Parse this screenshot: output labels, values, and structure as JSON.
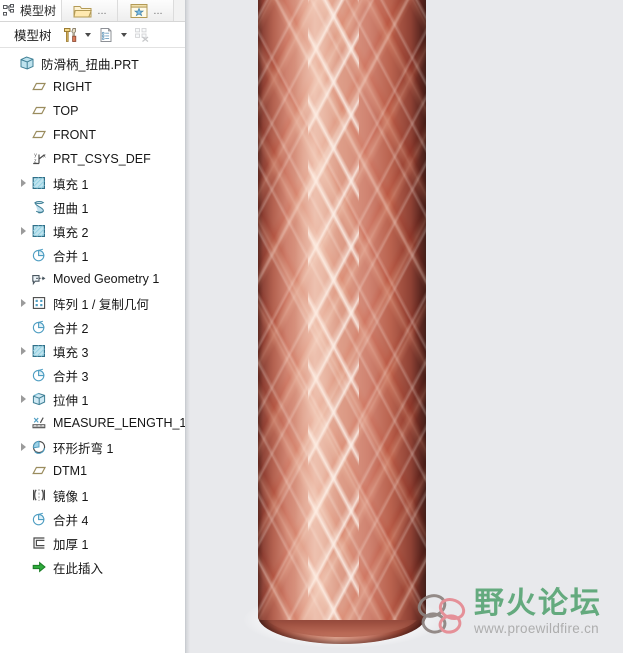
{
  "window": {
    "tabs": [
      {
        "label": "模型树",
        "icon": "tree-hierarchy-icon",
        "active": true
      }
    ],
    "tab_buttons": [
      {
        "name": "open-folder-button",
        "icon": "folder-open-icon",
        "overflow": "..."
      },
      {
        "name": "settings-star-button",
        "icon": "star-window-icon",
        "overflow": "..."
      }
    ]
  },
  "toolbar": {
    "label": "模型树",
    "items": [
      {
        "name": "tools-button",
        "icon": "hammer-screwdriver-icon",
        "has_caret": true
      },
      {
        "name": "tree-columns-button",
        "icon": "document-list-icon",
        "has_caret": true
      },
      {
        "name": "tree-filter-button",
        "icon": "filter-grid-icon",
        "has_caret": false,
        "disabled": true
      }
    ]
  },
  "tree": {
    "items": [
      {
        "label": "防滑柄_扭曲.PRT",
        "icon": "part-cube-icon",
        "indent": 0,
        "expandable": false
      },
      {
        "label": "RIGHT",
        "icon": "datum-plane-icon",
        "indent": 1,
        "expandable": false
      },
      {
        "label": "TOP",
        "icon": "datum-plane-icon",
        "indent": 1,
        "expandable": false
      },
      {
        "label": "FRONT",
        "icon": "datum-plane-icon",
        "indent": 1,
        "expandable": false
      },
      {
        "label": "PRT_CSYS_DEF",
        "icon": "coordinate-system-icon",
        "indent": 1,
        "expandable": false
      },
      {
        "label": "填充 1",
        "icon": "fill-surface-icon",
        "indent": 1,
        "expandable": true
      },
      {
        "label": "扭曲 1",
        "icon": "twist-icon",
        "indent": 1,
        "expandable": false
      },
      {
        "label": "填充 2",
        "icon": "fill-surface-icon",
        "indent": 1,
        "expandable": true
      },
      {
        "label": "合并 1",
        "icon": "merge-icon",
        "indent": 1,
        "expandable": false
      },
      {
        "label": "Moved Geometry 1",
        "icon": "moved-geometry-icon",
        "indent": 1,
        "expandable": false
      },
      {
        "label": "阵列 1 / 复制几何",
        "icon": "pattern-icon",
        "indent": 1,
        "expandable": true
      },
      {
        "label": "合并 2",
        "icon": "merge-icon",
        "indent": 1,
        "expandable": false
      },
      {
        "label": "填充 3",
        "icon": "fill-surface-icon",
        "indent": 1,
        "expandable": true
      },
      {
        "label": "合并 3",
        "icon": "merge-icon",
        "indent": 1,
        "expandable": false
      },
      {
        "label": "拉伸 1",
        "icon": "extrude-icon",
        "indent": 1,
        "expandable": true
      },
      {
        "label": "MEASURE_LENGTH_1",
        "icon": "measure-ruler-icon",
        "indent": 1,
        "expandable": false
      },
      {
        "label": "环形折弯 1",
        "icon": "toroidal-bend-icon",
        "indent": 1,
        "expandable": true
      },
      {
        "label": "DTM1",
        "icon": "datum-plane-icon",
        "indent": 1,
        "expandable": false
      },
      {
        "label": "镜像 1",
        "icon": "mirror-icon",
        "indent": 1,
        "expandable": false
      },
      {
        "label": "合并 4",
        "icon": "merge-icon",
        "indent": 1,
        "expandable": false
      },
      {
        "label": "加厚 1",
        "icon": "thicken-icon",
        "indent": 1,
        "expandable": false
      },
      {
        "label": "在此插入",
        "icon": "insert-here-arrow-icon",
        "indent": 1,
        "expandable": false
      }
    ]
  },
  "viewport": {
    "name": "graphics-window",
    "background_color": "#e8e9ec",
    "model": {
      "name": "knurled-handle-model",
      "surface_color": "#dd9c87",
      "shadow_color": "#5d2b23",
      "pattern": "diamond-knurl"
    }
  },
  "watermark": {
    "title": "野火论坛",
    "url": "www.proewildfire.cn",
    "title_color": "#5ba676",
    "url_color": "#a9a9a9",
    "logo": "butterfly-logo-icon"
  }
}
